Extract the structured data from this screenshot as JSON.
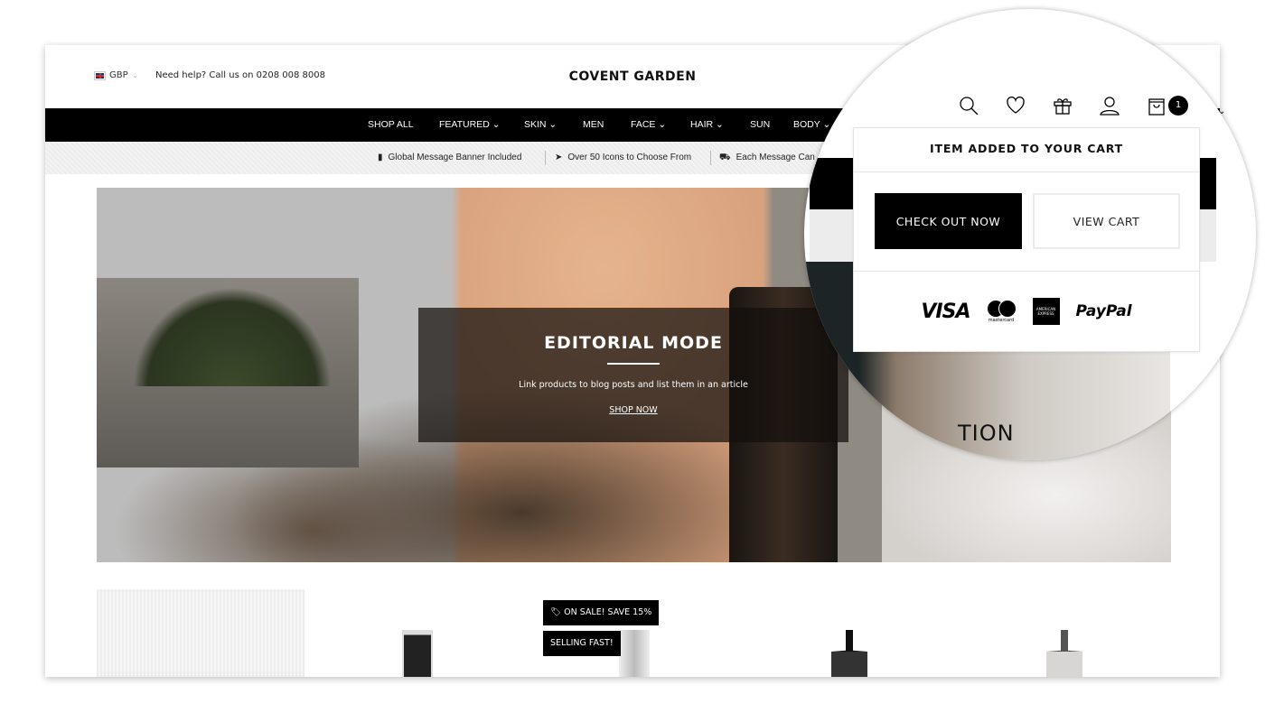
{
  "header": {
    "currency": "GBP",
    "help_text": "Need help? Call us on 0208 008 8008",
    "logo": "COVENT GARDEN"
  },
  "nav": {
    "items": [
      "SHOP ALL",
      "FEATURED ⌄",
      "SKIN ⌄",
      "MEN",
      "FACE ⌄",
      "HAIR ⌄",
      "SUN",
      "BODY ⌄"
    ]
  },
  "messages": [
    "Global Message Banner Included",
    "Over 50 Icons to Choose From",
    "Each Message Can"
  ],
  "hero": {
    "title": "EDITORIAL MODE",
    "subtitle": "Link products to blog posts and list them in an article",
    "cta": "SHOP NOW",
    "partial_text": "TION"
  },
  "badges": {
    "sale": "ON SALE! SAVE 15%",
    "selling": "SELLING FAST!"
  },
  "cart": {
    "count": "1",
    "popup_title": "ITEM ADDED TO YOUR CART",
    "checkout": "CHECK OUT NOW",
    "view_cart": "VIEW CART",
    "payments": {
      "visa": "VISA",
      "mastercard": "mastercard",
      "amex": "AMERICAN EXPRESS",
      "paypal": "PayPal"
    }
  }
}
